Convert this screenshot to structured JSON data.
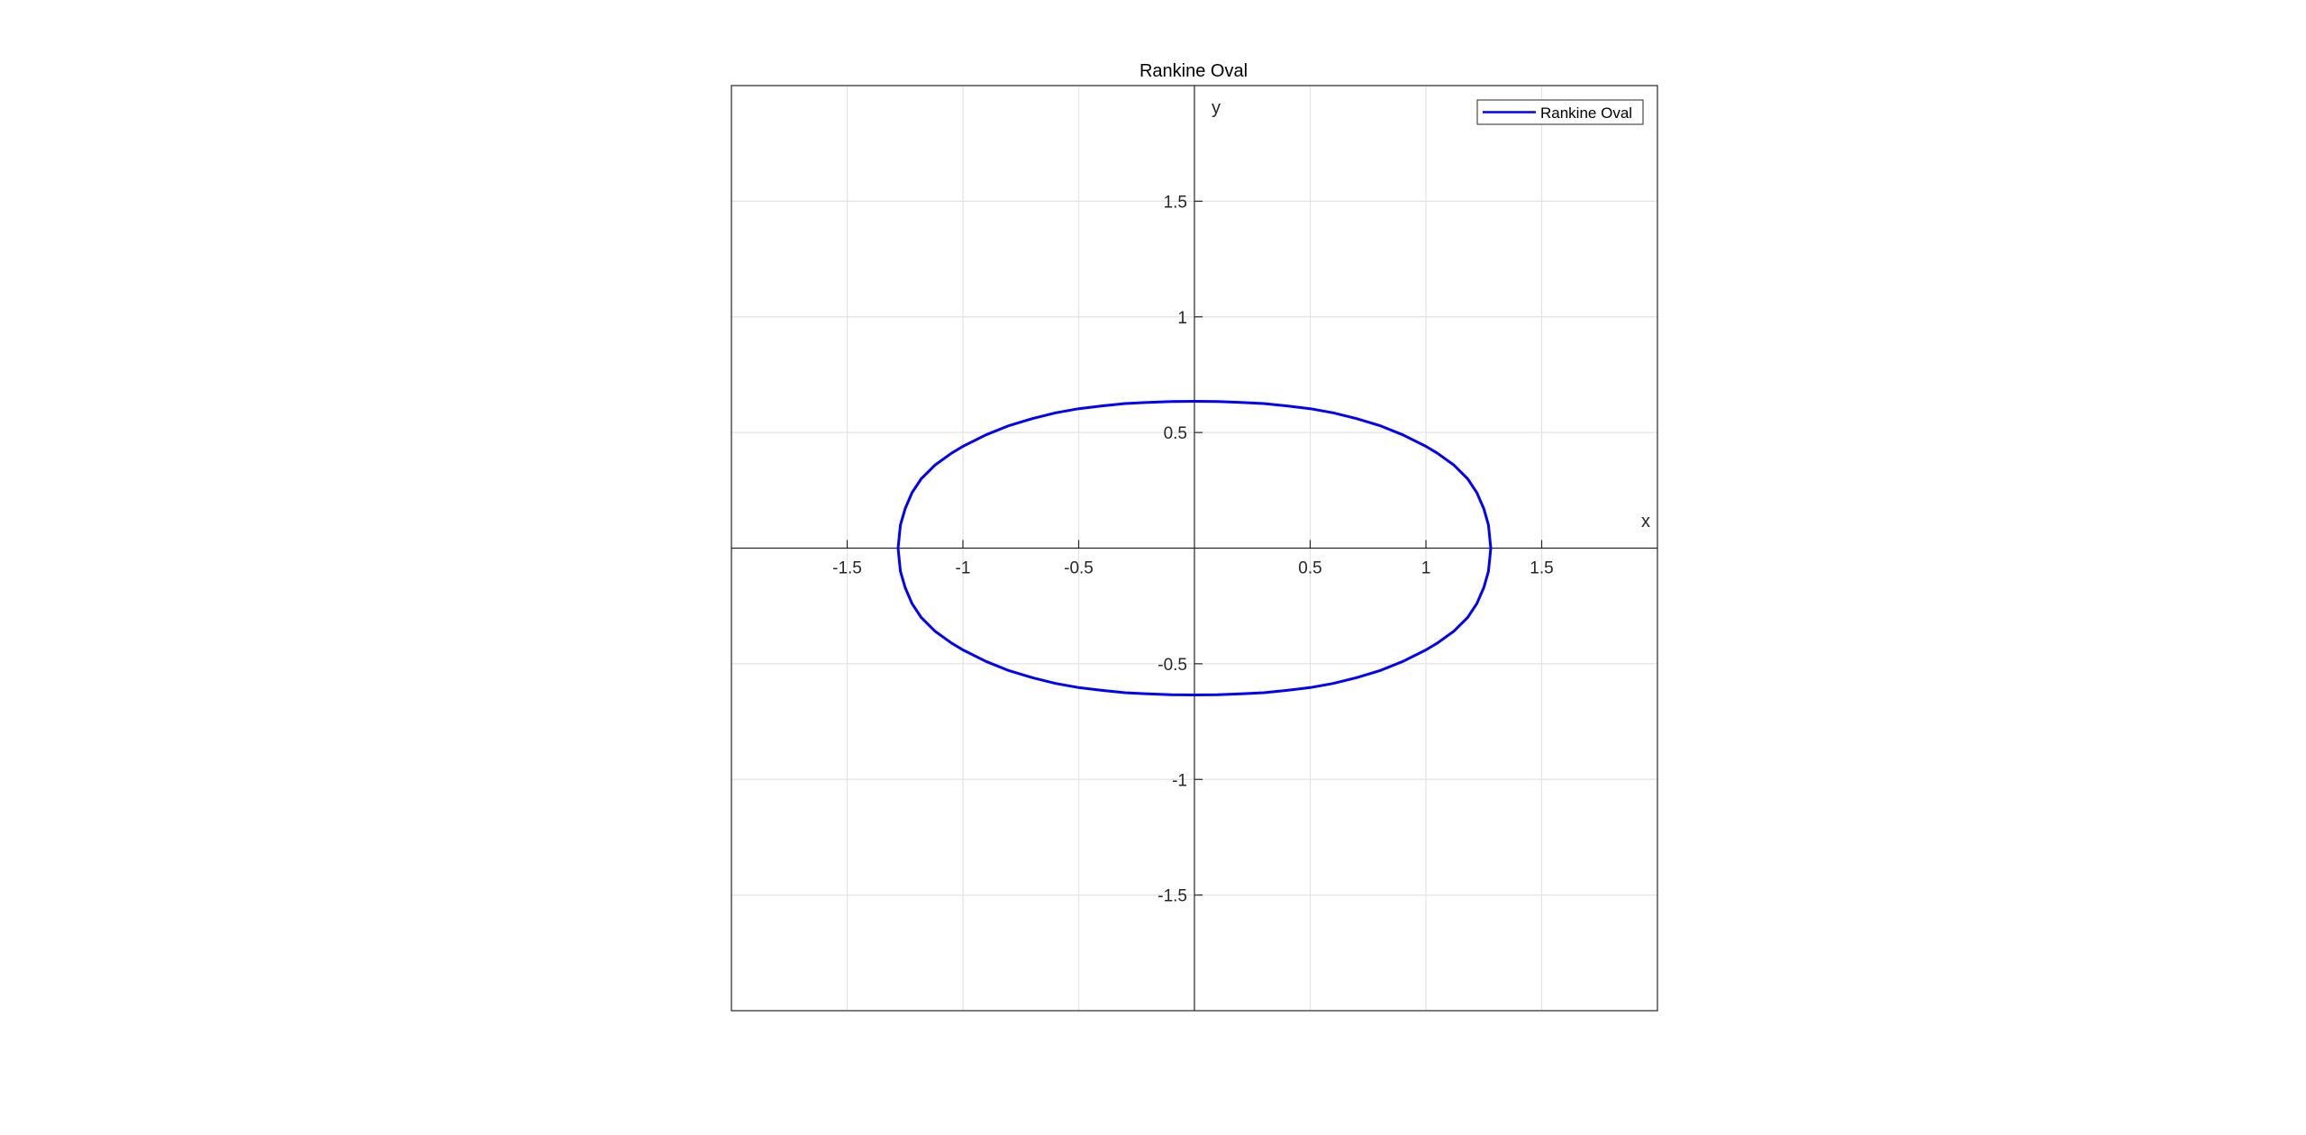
{
  "chart_data": {
    "type": "line",
    "title": "Rankine Oval",
    "xlabel": "x",
    "ylabel": "y",
    "xlim": [
      -2,
      2
    ],
    "ylim": [
      -2,
      2
    ],
    "grid": true,
    "axis_location": "origin",
    "legend_position": "top-right",
    "x_ticks": [
      -1.5,
      -1,
      -0.5,
      0.5,
      1,
      1.5
    ],
    "x_tick_labels": [
      "-1.5",
      "-1",
      "-0.5",
      "0.5",
      "1",
      "1.5"
    ],
    "y_ticks": [
      1.5,
      1,
      0.5,
      -0.5,
      -1,
      -1.5
    ],
    "y_tick_labels": [
      "1.5",
      "1",
      "0.5",
      "-0.5",
      "-1",
      "-1.5"
    ],
    "series": [
      {
        "name": "Rankine Oval",
        "color": "#0000ff",
        "x": [
          1.28,
          1.27,
          1.25,
          1.22,
          1.18,
          1.12,
          1.05,
          1.0,
          0.9,
          0.8,
          0.7,
          0.6,
          0.5,
          0.4,
          0.3,
          0.2,
          0.1,
          0.0,
          -0.1,
          -0.2,
          -0.3,
          -0.4,
          -0.5,
          -0.6,
          -0.7,
          -0.8,
          -0.9,
          -1.0,
          -1.05,
          -1.12,
          -1.18,
          -1.22,
          -1.25,
          -1.27,
          -1.28,
          -1.27,
          -1.25,
          -1.22,
          -1.18,
          -1.12,
          -1.05,
          -1.0,
          -0.9,
          -0.8,
          -0.7,
          -0.6,
          -0.5,
          -0.4,
          -0.3,
          -0.2,
          -0.1,
          0.0,
          0.1,
          0.2,
          0.3,
          0.4,
          0.5,
          0.6,
          0.7,
          0.8,
          0.9,
          1.0,
          1.05,
          1.12,
          1.18,
          1.22,
          1.25,
          1.27,
          1.28
        ],
        "y": [
          0.0,
          0.1,
          0.17,
          0.24,
          0.3,
          0.36,
          0.41,
          0.44,
          0.49,
          0.53,
          0.56,
          0.585,
          0.603,
          0.615,
          0.625,
          0.63,
          0.634,
          0.635,
          0.634,
          0.63,
          0.625,
          0.615,
          0.603,
          0.585,
          0.56,
          0.53,
          0.49,
          0.44,
          0.41,
          0.36,
          0.3,
          0.24,
          0.17,
          0.1,
          0.0,
          -0.1,
          -0.17,
          -0.24,
          -0.3,
          -0.36,
          -0.41,
          -0.44,
          -0.49,
          -0.53,
          -0.56,
          -0.585,
          -0.603,
          -0.615,
          -0.625,
          -0.63,
          -0.634,
          -0.635,
          -0.634,
          -0.63,
          -0.625,
          -0.615,
          -0.603,
          -0.585,
          -0.56,
          -0.53,
          -0.49,
          -0.44,
          -0.41,
          -0.36,
          -0.3,
          -0.24,
          -0.17,
          -0.1,
          0.0
        ]
      }
    ]
  }
}
